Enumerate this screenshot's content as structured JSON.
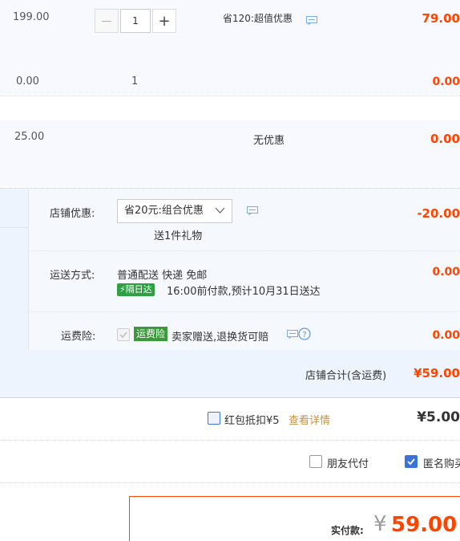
{
  "rows": [
    {
      "price": "199.00",
      "qty": "1",
      "promo": "省120:超值优惠",
      "amount": "79.00"
    },
    {
      "price": "0.00",
      "qty": "1",
      "amount": "0.00"
    },
    {
      "price": "25.00",
      "promo": "无优惠",
      "amount": "0.00"
    }
  ],
  "stepper": {
    "minus": "—",
    "plus": "+"
  },
  "shop_discount": {
    "label": "店铺优惠:",
    "selected": "省20元:组合优惠",
    "gift": "送1件礼物",
    "amount": "-20.00"
  },
  "shipping": {
    "label": "运送方式:",
    "method": "普通配送 快递 免邮",
    "badge": "隔日达",
    "note": "16:00前付款,预计10月31日送达",
    "amount": "0.00"
  },
  "insurance": {
    "label": "运费险:",
    "tag": "运费险",
    "text": "卖家赠送,退换货可赔",
    "amount": "0.00"
  },
  "shop_total": {
    "label": "店铺合计(含运费)",
    "amount": "¥59.00"
  },
  "red_packet": {
    "label": "红包抵扣¥5",
    "link": "查看详情",
    "amount": "¥5.00"
  },
  "options": {
    "friend_pay": "朋友代付",
    "anonymous": "匿名购买"
  },
  "payment": {
    "label": "实付款:",
    "currency": "¥",
    "amount": "59.00"
  },
  "colors": {
    "accent": "#ff4400",
    "band": "#f2f7ff",
    "blue": "#3a74d8"
  }
}
